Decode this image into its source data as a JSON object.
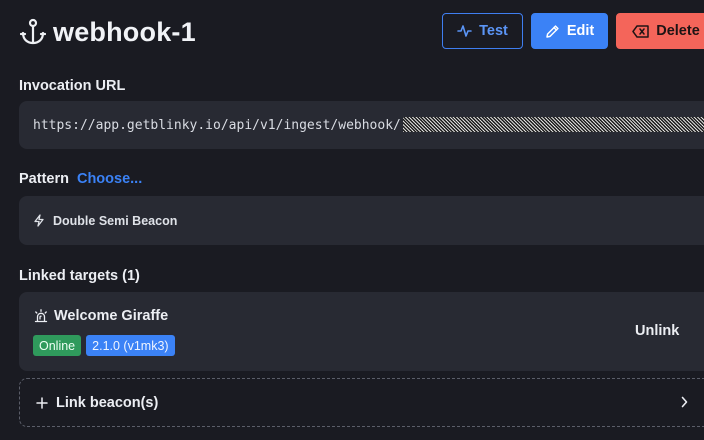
{
  "header": {
    "title": "webhook-1",
    "icon": "anchor-icon"
  },
  "actions": {
    "test_label": "Test",
    "edit_label": "Edit",
    "delete_label": "Delete"
  },
  "invocation": {
    "label": "Invocation URL",
    "url_prefix": "https://app.getblinky.io/api/v1/ingest/webhook/"
  },
  "pattern": {
    "label": "Pattern",
    "choose_label": "Choose...",
    "name": "Double Semi Beacon",
    "icon": "lightning-icon"
  },
  "linked_targets": {
    "label": "Linked targets (1)",
    "items": [
      {
        "name": "Welcome Giraffe",
        "icon": "siren-icon",
        "status": "Online",
        "version": "2.1.0 (v1mk3)",
        "unlink_label": "Unlink"
      }
    ],
    "link_label": "Link beacon(s)"
  },
  "colors": {
    "background": "#1a1b22",
    "card": "#282a33",
    "accent": "#3b82f6",
    "danger": "#f4655a",
    "success": "#2f9a5c"
  }
}
